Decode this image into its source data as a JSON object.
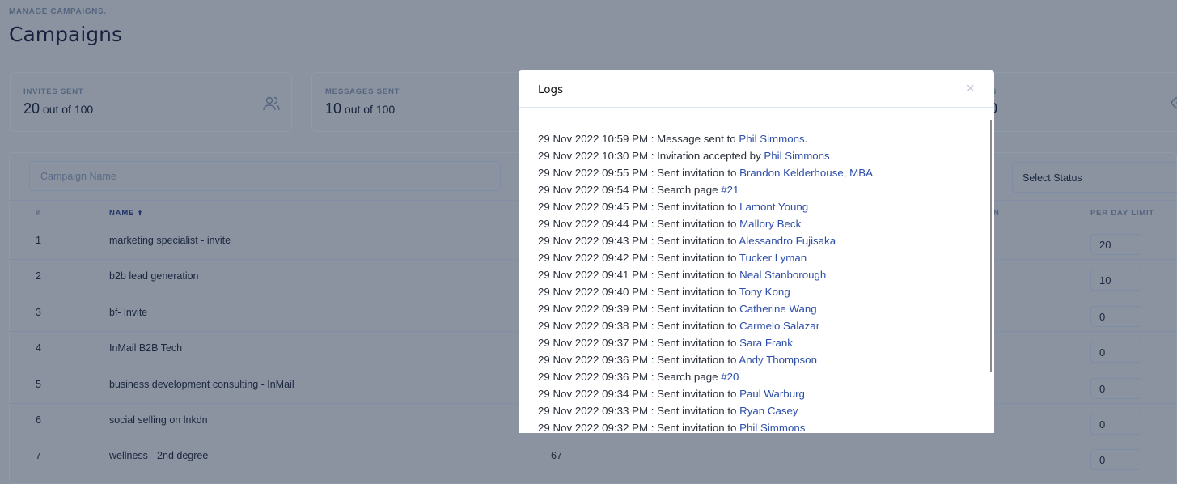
{
  "header": {
    "eyebrow": "MANAGE CAMPAIGNS.",
    "title": "Campaigns"
  },
  "stats": [
    {
      "label": "INVITES SENT",
      "value": "20",
      "suffix": "out of 100",
      "icon": "users-icon"
    },
    {
      "label": "MESSAGES SENT",
      "value": "10",
      "suffix": "out of 100"
    },
    {
      "label": "S",
      "value": "0",
      "icon": "eye-icon"
    }
  ],
  "filters": {
    "search_placeholder": "Campaign Name",
    "status_select": "Select Status"
  },
  "table": {
    "columns": [
      "#",
      "NAME",
      "N",
      "PER DAY LIMIT"
    ],
    "rows": [
      {
        "n": "1",
        "name": "marketing specialist - invite",
        "limit": "20"
      },
      {
        "n": "2",
        "name": "b2b lead generation",
        "limit": "10"
      },
      {
        "n": "3",
        "name": "bf- invite",
        "limit": "0"
      },
      {
        "n": "4",
        "name": "InMail B2B Tech",
        "limit": "0"
      },
      {
        "n": "5",
        "name": "business development consulting - InMail",
        "limit": "0"
      },
      {
        "n": "6",
        "name": "social selling on lnkdn",
        "limit": "0"
      },
      {
        "n": "7",
        "name": "wellness - 2nd degree",
        "c1": "67",
        "c2": "-",
        "c3": "-",
        "c4": "-",
        "limit": "0"
      }
    ]
  },
  "modal": {
    "title": "Logs",
    "close": "×",
    "logs": [
      {
        "time": "29 Nov 2022 10:59 PM",
        "text": " : Message sent to ",
        "link": "Phil Simmons",
        "after": "."
      },
      {
        "time": "29 Nov 2022 10:30 PM",
        "text": " : Invitation accepted by ",
        "link": "Phil Simmons"
      },
      {
        "time": "29 Nov 2022 09:55 PM",
        "text": " : Sent invitation to ",
        "link": "Brandon Kelderhouse, MBA"
      },
      {
        "time": "29 Nov 2022 09:54 PM",
        "text": " : Search page ",
        "link": "#21"
      },
      {
        "time": "29 Nov 2022 09:45 PM",
        "text": " : Sent invitation to ",
        "link": "Lamont Young"
      },
      {
        "time": "29 Nov 2022 09:44 PM",
        "text": " : Sent invitation to ",
        "link": "Mallory Beck"
      },
      {
        "time": "29 Nov 2022 09:43 PM",
        "text": " : Sent invitation to ",
        "link": "Alessandro Fujisaka"
      },
      {
        "time": "29 Nov 2022 09:42 PM",
        "text": " : Sent invitation to ",
        "link": "Tucker Lyman"
      },
      {
        "time": "29 Nov 2022 09:41 PM",
        "text": " : Sent invitation to ",
        "link": "Neal Stanborough"
      },
      {
        "time": "29 Nov 2022 09:40 PM",
        "text": " : Sent invitation to ",
        "link": "Tony Kong"
      },
      {
        "time": "29 Nov 2022 09:39 PM",
        "text": " : Sent invitation to ",
        "link": "Catherine Wang"
      },
      {
        "time": "29 Nov 2022 09:38 PM",
        "text": " : Sent invitation to ",
        "link": "Carmelo Salazar"
      },
      {
        "time": "29 Nov 2022 09:37 PM",
        "text": " : Sent invitation to ",
        "link": "Sara Frank"
      },
      {
        "time": "29 Nov 2022 09:36 PM",
        "text": " : Sent invitation to ",
        "link": "Andy Thompson"
      },
      {
        "time": "29 Nov 2022 09:36 PM",
        "text": " : Search page ",
        "link": "#20"
      },
      {
        "time": "29 Nov 2022 09:34 PM",
        "text": " : Sent invitation to ",
        "link": "Paul Warburg"
      },
      {
        "time": "29 Nov 2022 09:33 PM",
        "text": " : Sent invitation to ",
        "link": "Ryan Casey"
      },
      {
        "time": "29 Nov 2022 09:32 PM",
        "text": " : Sent invitation to ",
        "link": "Phil Simmons"
      }
    ]
  }
}
